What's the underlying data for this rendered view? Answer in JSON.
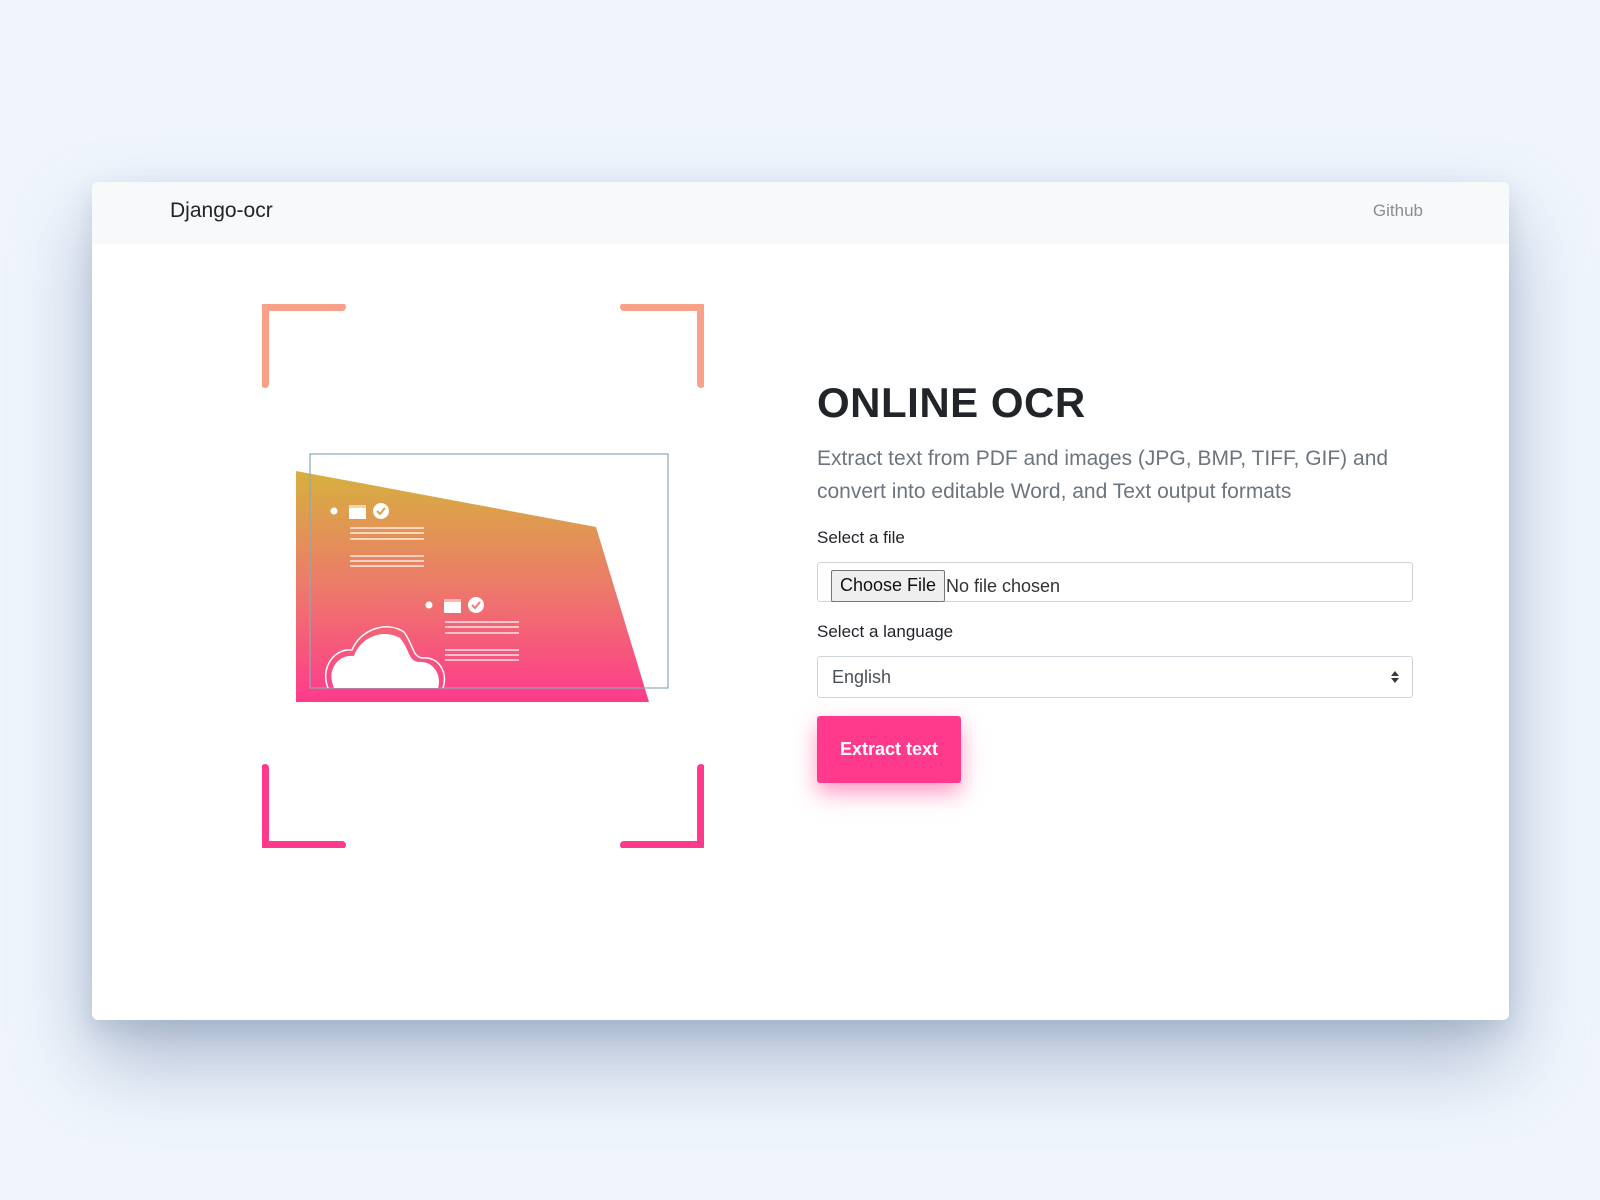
{
  "navbar": {
    "brand": "Django-ocr",
    "github_link": "Github"
  },
  "main": {
    "title": "ONLINE OCR",
    "description": "Extract text from PDF and images (JPG, BMP, TIFF, GIF) and convert into editable Word, and Text output formats",
    "file": {
      "label": "Select a file",
      "button_label": "Choose File",
      "status": "No file chosen"
    },
    "language": {
      "label": "Select a language",
      "selected": "English"
    },
    "submit_label": "Extract text"
  },
  "colors": {
    "accent": "#ff3a8c",
    "corner_top": "#f9a088",
    "corner_bottom": "#ff3a8c",
    "gradient_top": "#d6b13d",
    "gradient_bottom": "#ff3a8c"
  },
  "icons": {
    "select_arrow": "sort-arrows-icon",
    "illustration": "document-scan-illustration"
  }
}
